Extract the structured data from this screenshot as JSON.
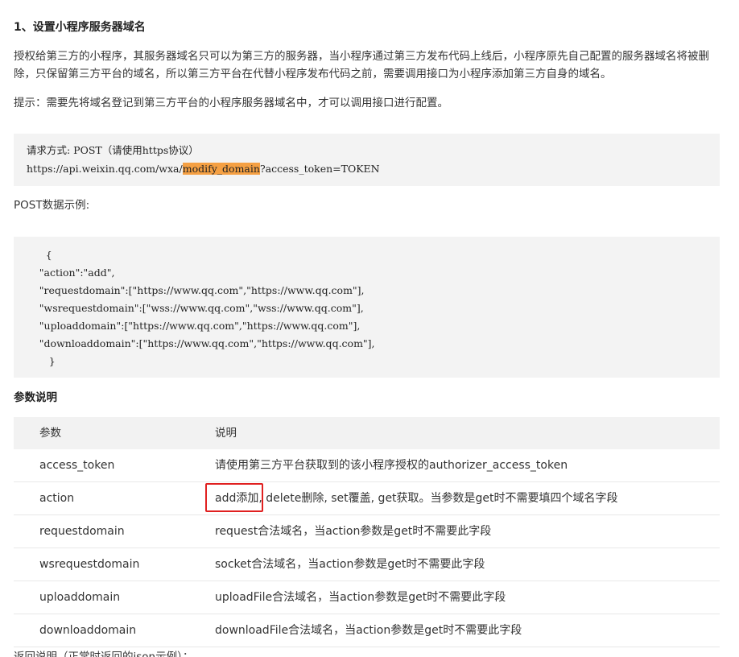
{
  "section_title": "1、设置小程序服务器域名",
  "intro_paragraph": "授权给第三方的小程序，其服务器域名只可以为第三方的服务器，当小程序通过第三方发布代码上线后，小程序原先自己配置的服务器域名将被删除，只保留第三方平台的域名，所以第三方平台在代替小程序发布代码之前，需要调用接口为小程序添加第三方自身的域名。",
  "tip_paragraph": "提示：需要先将域名登记到第三方平台的小程序服务器域名中，才可以调用接口进行配置。",
  "request": {
    "method_line": "请求方式: POST（请使用https协议）",
    "url_prefix": "https://api.weixin.qq.com/wxa/",
    "url_highlight": "modify_domain",
    "url_suffix": "?access_token=TOKEN"
  },
  "post_example_label": "POST数据示例:",
  "json_example_lines": [
    "          {",
    "        \"action\":\"add\",",
    "        \"requestdomain\":[\"https://www.qq.com\",\"https://www.qq.com\"],",
    "        \"wsrequestdomain\":[\"wss://www.qq.com\",\"wss://www.qq.com\"],",
    "        \"uploaddomain\":[\"https://www.qq.com\",\"https://www.qq.com\"],",
    "        \"downloaddomain\":[\"https://www.qq.com\",\"https://www.qq.com\"],",
    "           }"
  ],
  "params_title": "参数说明",
  "table": {
    "headers": [
      "参数",
      "说明"
    ],
    "rows": [
      {
        "param": "access_token",
        "desc": "请使用第三方平台获取到的该小程序授权的authorizer_access_token"
      },
      {
        "param": "action",
        "desc": "add添加, delete删除, set覆盖, get获取。当参数是get时不需要填四个域名字段"
      },
      {
        "param": "requestdomain",
        "desc": "request合法域名，当action参数是get时不需要此字段"
      },
      {
        "param": "wsrequestdomain",
        "desc": "socket合法域名，当action参数是get时不需要此字段"
      },
      {
        "param": "uploaddomain",
        "desc": "uploadFile合法域名，当action参数是get时不需要此字段"
      },
      {
        "param": "downloaddomain",
        "desc": "downloadFile合法域名，当action参数是get时不需要此字段"
      }
    ]
  },
  "bottom_text": "返回说明（正常时返回的json示例）：",
  "colors": {
    "highlight": "#f5a043",
    "annotation_box": "#e02020",
    "code_background": "#f3f3f3",
    "table_header_background": "#f2f2f2"
  }
}
